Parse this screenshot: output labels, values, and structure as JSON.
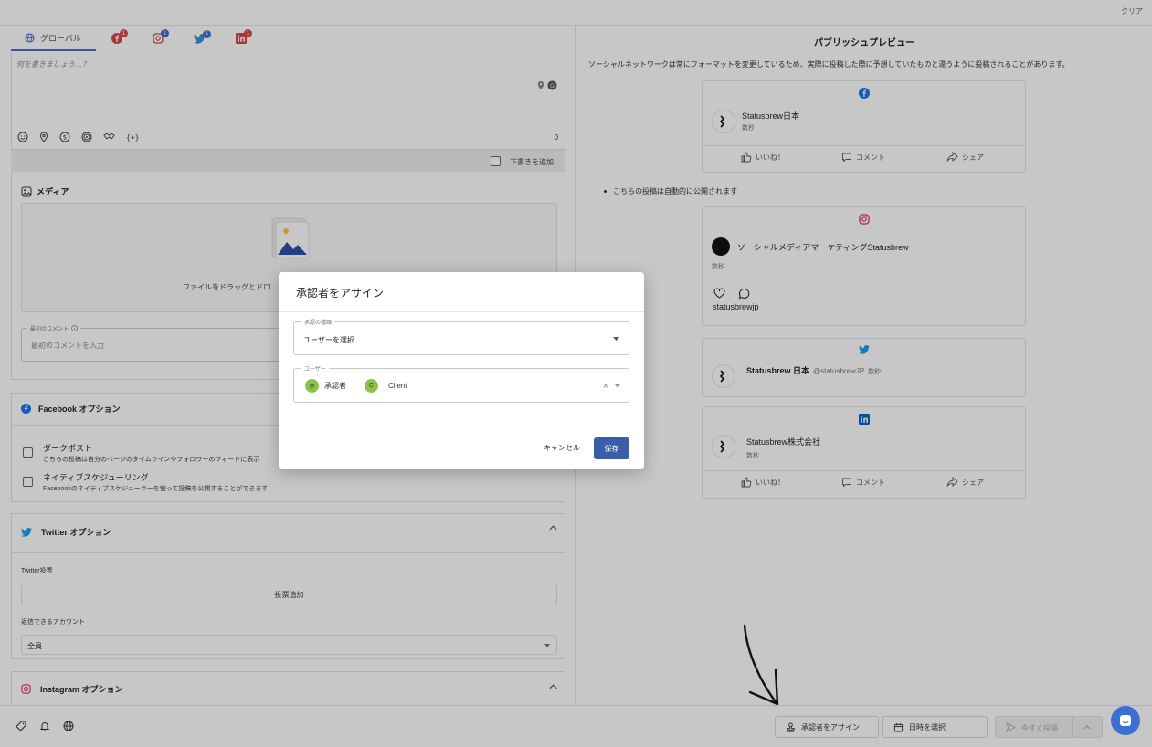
{
  "topbar": {
    "clear": "クリア"
  },
  "tabs": {
    "global": "グローバル",
    "badge": "1"
  },
  "composer": {
    "placeholder": "何を書きましょう…？",
    "count": "0",
    "variable": "{+}"
  },
  "draft": {
    "label": "下書きを追加"
  },
  "media": {
    "title": "メディア",
    "drop": "ファイルをドラッグとドロ"
  },
  "first_comment": {
    "label": "最初のコメント",
    "placeholder": "最初のコメントを入力"
  },
  "facebook_options": {
    "title": "Facebook オプション",
    "dark_post_title": "ダークポスト",
    "dark_post_desc": "こちらの投稿は自分のページのタイムラインやフォロワーのフィードに表示",
    "native_title": "ネイティブスケジューリング",
    "native_desc": "Facebookのネイティブスケジューラーを使って投稿を公開することができます"
  },
  "twitter_options": {
    "title": "Twitter オプション",
    "poll_label": "Twitter投票",
    "poll_button": "投票追加",
    "reply_label": "返信できるアカウント",
    "reply_value": "全員"
  },
  "instagram_options": {
    "title": "Instagram オプション"
  },
  "preview": {
    "title": "パブリッシュプレビュー",
    "notice": "ソーシャルネットワークは常にフォーマットを変更しているため、実際に投稿した際に予想していたものと違うように投稿されることがあります。",
    "auto_publish": "こちらの投稿は自動的に公開されます",
    "facebook": {
      "name": "Statusbrew日本",
      "time": "数秒",
      "like": "いいね！",
      "comment": "コメント",
      "share": "シェア"
    },
    "instagram": {
      "name": "ソーシャルメディアマーケティングStatusbrew",
      "time": "数秒",
      "handle": "statusbrewjp"
    },
    "twitter": {
      "name": "Statusbrew 日本",
      "handle": "@statusbrewJP",
      "time": "数秒"
    },
    "linkedin": {
      "name": "Statusbrew株式会社",
      "time": "数秒",
      "like": "いいね！",
      "comment": "コメント",
      "share": "シェア"
    }
  },
  "modal": {
    "title": "承認者をアサイン",
    "type_label": "承認の種類",
    "type_value": "ユーザーを選択",
    "user_label": "ユーザー",
    "chip1": "承認者",
    "chip1_initial": "承",
    "chip2": "Client",
    "chip2_initial": "C",
    "clear_x": "×",
    "cancel": "キャンセル",
    "save": "保存"
  },
  "bottombar": {
    "assign": "承認者をアサイン",
    "schedule": "日時を選択",
    "post_now": "今すぐ投稿"
  },
  "colors": {
    "accent": "#3b5ea8",
    "facebook": "#1877f2",
    "instagram": "#e1306c",
    "twitter": "#1da1f2",
    "linkedin": "#0a66c2",
    "badge": "#e14a4a",
    "chip": "#8bc34a"
  }
}
